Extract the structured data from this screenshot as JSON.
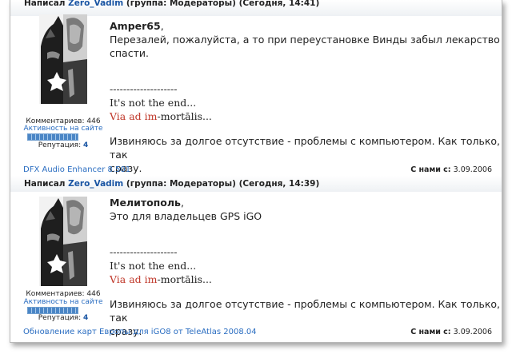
{
  "post1": {
    "header_prefix": "Написал",
    "author": "Zero_Vadim",
    "group": "(группа: Модераторы) (Сегодня, 14:41)",
    "comments": "Комментариев: 446",
    "activity": "Активность на сайте",
    "reputation_label": "Репутация:",
    "reputation_value": "4",
    "addressee": "Amper65",
    "addressee_suffix": ",",
    "message_line1": "Перезалей, пожалуйста, а то при переустановке Винды забыл лекарство",
    "message_line2": "спасти.",
    "sig_divider": "--------------------",
    "sig_line1": "It's not the end...",
    "sig_via": "Via ",
    "sig_ad": "ad im",
    "sig_rest": "-mortālis...",
    "sig_line3": "Извиняюсь за долгое отсутствие - проблемы с компьютером. Как только, так",
    "sig_line4": "сразу.",
    "footer_link": "DFX Audio Enhancer 8.501",
    "footer_joined_label": "С нами с:",
    "footer_joined_value": "3.09.2006"
  },
  "post2": {
    "header_prefix": "Написал",
    "author": "Zero_Vadim",
    "group": "(группа: Модераторы) (Сегодня, 14:39)",
    "comments": "Комментариев: 446",
    "activity": "Активность на сайте",
    "reputation_label": "Репутация:",
    "reputation_value": "4",
    "addressee": "Мелитополь",
    "addressee_suffix": ",",
    "message_line1": "Это для владельцев GPS iGO",
    "sig_divider": "--------------------",
    "sig_line1": "It's not the end...",
    "sig_via": "Via ",
    "sig_ad": "ad im",
    "sig_rest": "-mortālis...",
    "sig_line3": "Извиняюсь за долгое отсутствие - проблемы с компьютером. Как только, так",
    "sig_line4": "сразу.",
    "footer_link": "Обновление карт Европы для iGO8 от TeleAtlas 2008.04",
    "footer_joined_label": "С нами с:",
    "footer_joined_value": "3.09.2006"
  },
  "activity_level": 1.0
}
